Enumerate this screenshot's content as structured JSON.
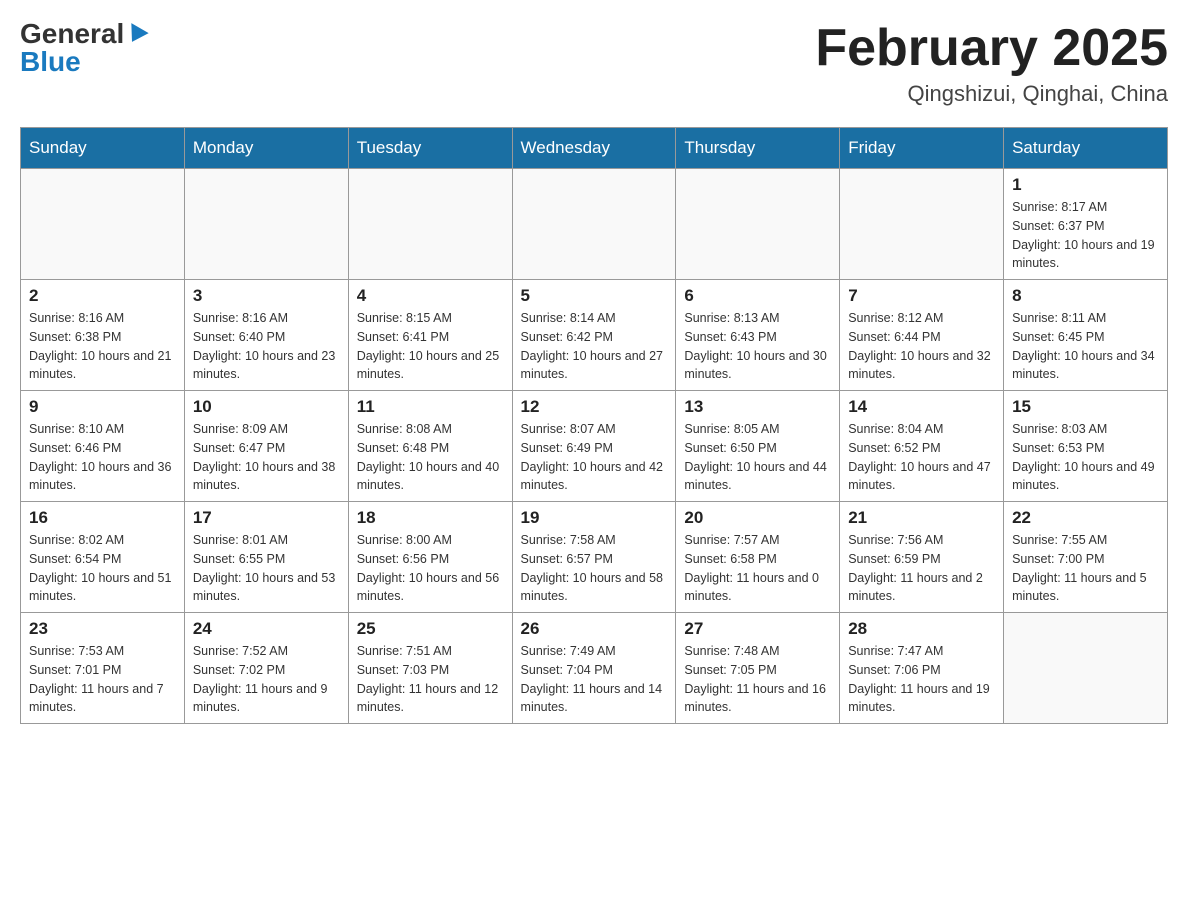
{
  "header": {
    "logo_general": "General",
    "logo_blue": "Blue",
    "month_title": "February 2025",
    "location": "Qingshizui, Qinghai, China"
  },
  "days_of_week": [
    "Sunday",
    "Monday",
    "Tuesday",
    "Wednesday",
    "Thursday",
    "Friday",
    "Saturday"
  ],
  "weeks": [
    [
      {
        "day": "",
        "info": ""
      },
      {
        "day": "",
        "info": ""
      },
      {
        "day": "",
        "info": ""
      },
      {
        "day": "",
        "info": ""
      },
      {
        "day": "",
        "info": ""
      },
      {
        "day": "",
        "info": ""
      },
      {
        "day": "1",
        "info": "Sunrise: 8:17 AM\nSunset: 6:37 PM\nDaylight: 10 hours and 19 minutes."
      }
    ],
    [
      {
        "day": "2",
        "info": "Sunrise: 8:16 AM\nSunset: 6:38 PM\nDaylight: 10 hours and 21 minutes."
      },
      {
        "day": "3",
        "info": "Sunrise: 8:16 AM\nSunset: 6:40 PM\nDaylight: 10 hours and 23 minutes."
      },
      {
        "day": "4",
        "info": "Sunrise: 8:15 AM\nSunset: 6:41 PM\nDaylight: 10 hours and 25 minutes."
      },
      {
        "day": "5",
        "info": "Sunrise: 8:14 AM\nSunset: 6:42 PM\nDaylight: 10 hours and 27 minutes."
      },
      {
        "day": "6",
        "info": "Sunrise: 8:13 AM\nSunset: 6:43 PM\nDaylight: 10 hours and 30 minutes."
      },
      {
        "day": "7",
        "info": "Sunrise: 8:12 AM\nSunset: 6:44 PM\nDaylight: 10 hours and 32 minutes."
      },
      {
        "day": "8",
        "info": "Sunrise: 8:11 AM\nSunset: 6:45 PM\nDaylight: 10 hours and 34 minutes."
      }
    ],
    [
      {
        "day": "9",
        "info": "Sunrise: 8:10 AM\nSunset: 6:46 PM\nDaylight: 10 hours and 36 minutes."
      },
      {
        "day": "10",
        "info": "Sunrise: 8:09 AM\nSunset: 6:47 PM\nDaylight: 10 hours and 38 minutes."
      },
      {
        "day": "11",
        "info": "Sunrise: 8:08 AM\nSunset: 6:48 PM\nDaylight: 10 hours and 40 minutes."
      },
      {
        "day": "12",
        "info": "Sunrise: 8:07 AM\nSunset: 6:49 PM\nDaylight: 10 hours and 42 minutes."
      },
      {
        "day": "13",
        "info": "Sunrise: 8:05 AM\nSunset: 6:50 PM\nDaylight: 10 hours and 44 minutes."
      },
      {
        "day": "14",
        "info": "Sunrise: 8:04 AM\nSunset: 6:52 PM\nDaylight: 10 hours and 47 minutes."
      },
      {
        "day": "15",
        "info": "Sunrise: 8:03 AM\nSunset: 6:53 PM\nDaylight: 10 hours and 49 minutes."
      }
    ],
    [
      {
        "day": "16",
        "info": "Sunrise: 8:02 AM\nSunset: 6:54 PM\nDaylight: 10 hours and 51 minutes."
      },
      {
        "day": "17",
        "info": "Sunrise: 8:01 AM\nSunset: 6:55 PM\nDaylight: 10 hours and 53 minutes."
      },
      {
        "day": "18",
        "info": "Sunrise: 8:00 AM\nSunset: 6:56 PM\nDaylight: 10 hours and 56 minutes."
      },
      {
        "day": "19",
        "info": "Sunrise: 7:58 AM\nSunset: 6:57 PM\nDaylight: 10 hours and 58 minutes."
      },
      {
        "day": "20",
        "info": "Sunrise: 7:57 AM\nSunset: 6:58 PM\nDaylight: 11 hours and 0 minutes."
      },
      {
        "day": "21",
        "info": "Sunrise: 7:56 AM\nSunset: 6:59 PM\nDaylight: 11 hours and 2 minutes."
      },
      {
        "day": "22",
        "info": "Sunrise: 7:55 AM\nSunset: 7:00 PM\nDaylight: 11 hours and 5 minutes."
      }
    ],
    [
      {
        "day": "23",
        "info": "Sunrise: 7:53 AM\nSunset: 7:01 PM\nDaylight: 11 hours and 7 minutes."
      },
      {
        "day": "24",
        "info": "Sunrise: 7:52 AM\nSunset: 7:02 PM\nDaylight: 11 hours and 9 minutes."
      },
      {
        "day": "25",
        "info": "Sunrise: 7:51 AM\nSunset: 7:03 PM\nDaylight: 11 hours and 12 minutes."
      },
      {
        "day": "26",
        "info": "Sunrise: 7:49 AM\nSunset: 7:04 PM\nDaylight: 11 hours and 14 minutes."
      },
      {
        "day": "27",
        "info": "Sunrise: 7:48 AM\nSunset: 7:05 PM\nDaylight: 11 hours and 16 minutes."
      },
      {
        "day": "28",
        "info": "Sunrise: 7:47 AM\nSunset: 7:06 PM\nDaylight: 11 hours and 19 minutes."
      },
      {
        "day": "",
        "info": ""
      }
    ]
  ]
}
